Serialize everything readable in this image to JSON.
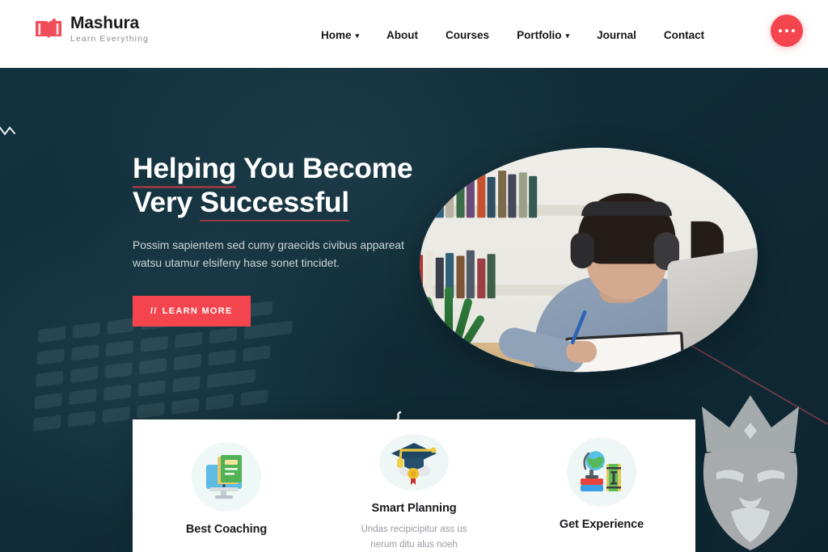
{
  "brand": {
    "name": "Mashura",
    "tagline": "Learn Everything",
    "logo_icon": "open-book-checkmark-icon"
  },
  "nav": {
    "items": [
      {
        "label": "Home",
        "has_dropdown": true,
        "caret": "▾"
      },
      {
        "label": "About",
        "has_dropdown": false,
        "caret": ""
      },
      {
        "label": "Courses",
        "has_dropdown": false,
        "caret": ""
      },
      {
        "label": "Portfolio",
        "has_dropdown": true,
        "caret": "▾"
      },
      {
        "label": "Journal",
        "has_dropdown": false,
        "caret": ""
      },
      {
        "label": "Contact",
        "has_dropdown": false,
        "caret": ""
      }
    ],
    "menu_button_icon": "ellipsis-icon"
  },
  "hero": {
    "heading_line1_a": "Helping",
    "heading_line1_b": " You Become",
    "heading_line2_a": "Very ",
    "heading_line2_b": "Successful",
    "paragraph": "Possim sapientem sed cumy graecids civibus appareat watsu utamur elsifeny hase sonet tincidet.",
    "cta_prefix": "//",
    "cta_label": "LEARN MORE",
    "image_alt": "woman-with-headphones-studying-at-laptop",
    "decor_squiggle": "zigzag-squiggle-icon",
    "decor_line": "diagonal-accent-line"
  },
  "features": [
    {
      "icon": "monitor-with-book-icon",
      "title": "Best Coaching",
      "desc": ""
    },
    {
      "icon": "graduation-cap-diploma-icon",
      "title": "Smart Planning",
      "desc": "Undas recipicipitur ass us nerum ditu alus noeh"
    },
    {
      "icon": "globe-with-books-icon",
      "title": "Get Experience",
      "desc": ""
    }
  ],
  "watermark": {
    "icon": "bearded-king-crown-watermark"
  },
  "colors": {
    "accent": "#f4454f",
    "hero_bg": "#12303d",
    "heading": "#ffffff",
    "underline": "#8e3a44",
    "nav_text": "#16161a",
    "body_text": "#cdd6da"
  }
}
